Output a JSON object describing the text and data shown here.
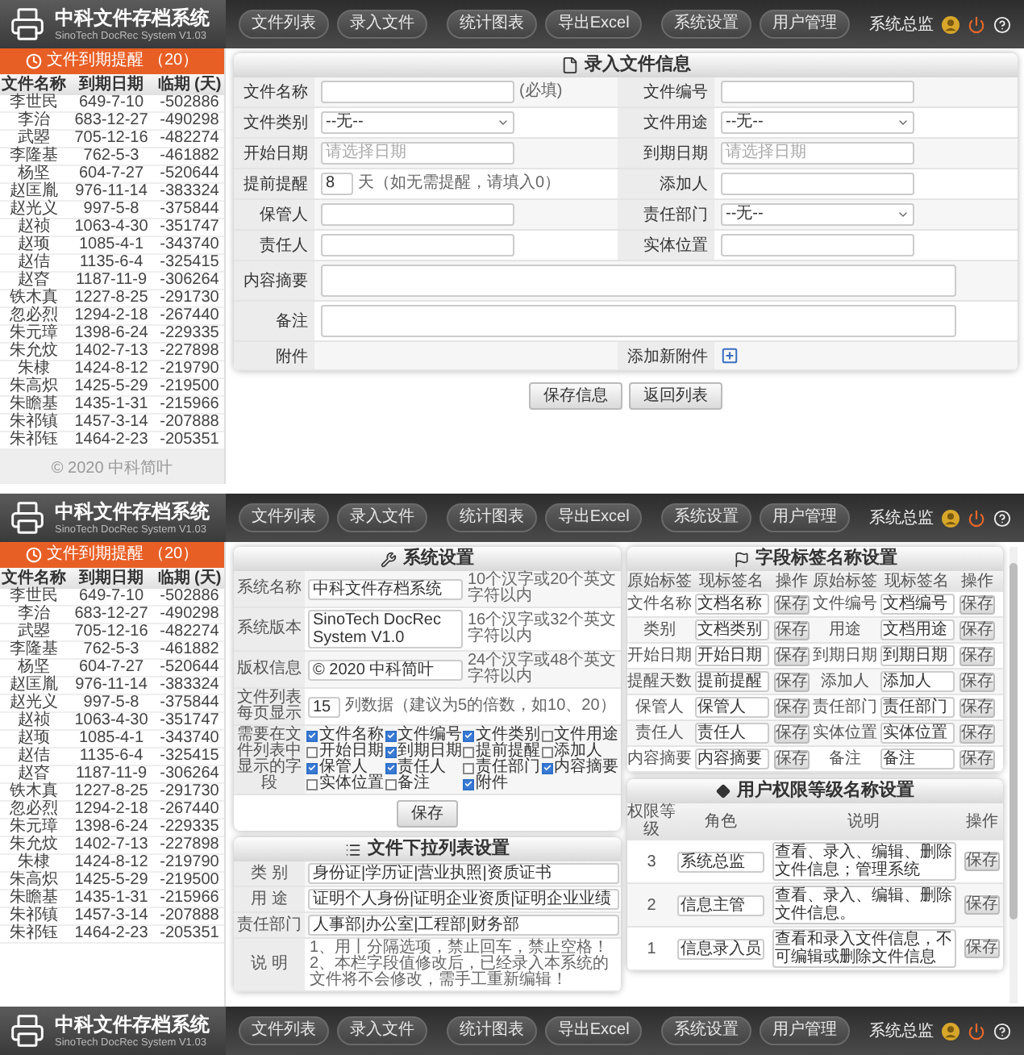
{
  "screens": [
    {
      "kind": "entry",
      "header": {
        "title": "中科文件存档系统",
        "subtitle": "SinoTech DocRec System V1.03",
        "nav": [
          [
            "文件列表",
            "录入文件"
          ],
          [
            "统计图表",
            "导出Excel"
          ],
          [
            "系统设置",
            "用户管理"
          ]
        ],
        "user": "系统总监"
      },
      "sidebar": {
        "title": "文件到期提醒",
        "count": "（20）",
        "columns": [
          "文件名称",
          "到期日期",
          "临期 (天)"
        ],
        "rows": [
          [
            "李世民",
            "649-7-10",
            "-502886"
          ],
          [
            "李治",
            "683-12-27",
            "-490298"
          ],
          [
            "武曌",
            "705-12-16",
            "-482274"
          ],
          [
            "李隆基",
            "762-5-3",
            "-461882"
          ],
          [
            "杨坚",
            "604-7-27",
            "-520644"
          ],
          [
            "赵匡胤",
            "976-11-14",
            "-383324"
          ],
          [
            "赵光义",
            "997-5-8",
            "-375844"
          ],
          [
            "赵祯",
            "1063-4-30",
            "-351747"
          ],
          [
            "赵顼",
            "1085-4-1",
            "-343740"
          ],
          [
            "赵佶",
            "1135-6-4",
            "-325415"
          ],
          [
            "赵昚",
            "1187-11-9",
            "-306264"
          ],
          [
            "铁木真",
            "1227-8-25",
            "-291730"
          ],
          [
            "忽必烈",
            "1294-2-18",
            "-267440"
          ],
          [
            "朱元璋",
            "1398-6-24",
            "-229335"
          ],
          [
            "朱允炆",
            "1402-7-13",
            "-227898"
          ],
          [
            "朱棣",
            "1424-8-12",
            "-219790"
          ],
          [
            "朱高炽",
            "1425-5-29",
            "-219500"
          ],
          [
            "朱瞻基",
            "1435-1-31",
            "-215966"
          ],
          [
            "朱祁镇",
            "1457-3-14",
            "-207888"
          ],
          [
            "朱祁钰",
            "1464-2-23",
            "-205351"
          ]
        ],
        "footer": "© 2020 中科简叶"
      },
      "form": {
        "title": "录入文件信息",
        "rows": [
          {
            "cells": [
              {
                "label": "文件名称",
                "kind": "input",
                "note": "(必填)"
              },
              {
                "label": "文件编号",
                "kind": "input"
              }
            ]
          },
          {
            "cells": [
              {
                "label": "文件类别",
                "kind": "select",
                "value": "--无--"
              },
              {
                "label": "文件用途",
                "kind": "select",
                "value": "--无--"
              }
            ]
          },
          {
            "cells": [
              {
                "label": "开始日期",
                "kind": "input",
                "placeholder": "请选择日期"
              },
              {
                "label": "到期日期",
                "kind": "input",
                "placeholder": "请选择日期"
              }
            ]
          },
          {
            "cells": [
              {
                "label": "提前提醒",
                "kind": "days",
                "value": "8",
                "note": "天（如无需提醒，请填入0）"
              },
              {
                "label": "添加人",
                "kind": "input"
              }
            ]
          },
          {
            "cells": [
              {
                "label": "保管人",
                "kind": "input"
              },
              {
                "label": "责任部门",
                "kind": "select",
                "value": "--无--"
              }
            ]
          },
          {
            "cells": [
              {
                "label": "责任人",
                "kind": "input"
              },
              {
                "label": "实体位置",
                "kind": "input"
              }
            ]
          },
          {
            "cells": [
              {
                "label": "内容摘要",
                "kind": "textarea"
              }
            ]
          },
          {
            "cells": [
              {
                "label": "备注",
                "kind": "textarea"
              }
            ]
          },
          {
            "cells": [
              {
                "label": "附件",
                "kind": "empty"
              },
              {
                "label": "添加新附件",
                "kind": "upload"
              }
            ]
          }
        ],
        "buttons": [
          "保存信息",
          "返回列表"
        ]
      }
    },
    {
      "kind": "settings",
      "header": {
        "title": "中科文件存档系统",
        "subtitle": "SinoTech DocRec System V1.03",
        "nav": [
          [
            "文件列表",
            "录入文件"
          ],
          [
            "统计图表",
            "导出Excel"
          ],
          [
            "系统设置",
            "用户管理"
          ]
        ],
        "user": "系统总监"
      },
      "sidebar": {
        "title": "文件到期提醒",
        "count": "（20）",
        "columns": [
          "文件名称",
          "到期日期",
          "临期 (天)"
        ],
        "rows": [
          [
            "李世民",
            "649-7-10",
            "-502886"
          ],
          [
            "李治",
            "683-12-27",
            "-490298"
          ],
          [
            "武曌",
            "705-12-16",
            "-482274"
          ],
          [
            "李隆基",
            "762-5-3",
            "-461882"
          ],
          [
            "杨坚",
            "604-7-27",
            "-520644"
          ],
          [
            "赵匡胤",
            "976-11-14",
            "-383324"
          ],
          [
            "赵光义",
            "997-5-8",
            "-375844"
          ],
          [
            "赵祯",
            "1063-4-30",
            "-351747"
          ],
          [
            "赵顼",
            "1085-4-1",
            "-343740"
          ],
          [
            "赵佶",
            "1135-6-4",
            "-325415"
          ],
          [
            "赵昚",
            "1187-11-9",
            "-306264"
          ],
          [
            "铁木真",
            "1227-8-25",
            "-291730"
          ],
          [
            "忽必烈",
            "1294-2-18",
            "-267440"
          ],
          [
            "朱元璋",
            "1398-6-24",
            "-229335"
          ],
          [
            "朱允炆",
            "1402-7-13",
            "-227898"
          ],
          [
            "朱棣",
            "1424-8-12",
            "-219790"
          ],
          [
            "朱高炽",
            "1425-5-29",
            "-219500"
          ],
          [
            "朱瞻基",
            "1435-1-31",
            "-215966"
          ],
          [
            "朱祁镇",
            "1457-3-14",
            "-207888"
          ],
          [
            "朱祁钰",
            "1464-2-23",
            "-205351"
          ]
        ]
      },
      "system_settings": {
        "title": "系统设置",
        "rows": [
          {
            "kind": "text",
            "label": "系统名称",
            "value": "中科文件存档系统",
            "note": "10个汉字或20个英文字符以内"
          },
          {
            "kind": "text",
            "label": "系统版本",
            "value": "SinoTech DocRec System V1.0",
            "note": "16个汉字或32个英文字符以内"
          },
          {
            "kind": "text",
            "label": "版权信息",
            "value": "© 2020 中科简叶",
            "note": "24个汉字或48个英文字符以内"
          },
          {
            "kind": "number",
            "label": "文件列表每页显示",
            "value": "15",
            "note": "列数据（建议为5的倍数，如10、20）"
          },
          {
            "kind": "checks",
            "label": "需要在文件列表中显示的字段",
            "options": [
              {
                "label": "文件名称",
                "checked": true
              },
              {
                "label": "文件编号",
                "checked": true
              },
              {
                "label": "文件类别",
                "checked": true
              },
              {
                "label": "文件用途",
                "checked": false
              },
              {
                "label": "开始日期",
                "checked": false
              },
              {
                "label": "到期日期",
                "checked": true
              },
              {
                "label": "提前提醒",
                "checked": false
              },
              {
                "label": "添加人",
                "checked": false
              },
              {
                "label": "保管人",
                "checked": true
              },
              {
                "label": "责任人",
                "checked": true
              },
              {
                "label": "责任部门",
                "checked": false
              },
              {
                "label": "内容摘要",
                "checked": true
              },
              {
                "label": "实体位置",
                "checked": false
              },
              {
                "label": "备注",
                "checked": false
              },
              {
                "label": "附件",
                "checked": true
              }
            ]
          }
        ],
        "button": "保存"
      },
      "dropdown_settings": {
        "title": "文件下拉列表设置",
        "rows": [
          {
            "label": "类 别",
            "value": "身份证|学历证|营业执照|资质证书"
          },
          {
            "label": "用 途",
            "value": "证明个人身份|证明企业资质|证明企业业绩"
          },
          {
            "label": "责任部门",
            "value": "人事部|办公室|工程部|财务部"
          }
        ],
        "note": {
          "label": "说 明",
          "lines": [
            "1、用丨分隔选项，禁止回车，禁止空格！",
            "2、本栏字段值修改后，已经录入本系统的文件将不会修改，需手工重新编辑！"
          ]
        }
      },
      "field_labels": {
        "title": "字段标签名称设置",
        "columns": [
          "原始标签",
          "现标签名",
          "操作",
          "原始标签",
          "现标签名",
          "操作"
        ],
        "rows": [
          [
            "文件名称",
            "文档名称",
            "保存",
            "文件编号",
            "文档编号",
            "保存"
          ],
          [
            "类别",
            "文档类别",
            "保存",
            "用途",
            "文档用途",
            "保存"
          ],
          [
            "开始日期",
            "开始日期",
            "保存",
            "到期日期",
            "到期日期",
            "保存"
          ],
          [
            "提醒天数",
            "提前提醒",
            "保存",
            "添加人",
            "添加人",
            "保存"
          ],
          [
            "保管人",
            "保管人",
            "保存",
            "责任部门",
            "责任部门",
            "保存"
          ],
          [
            "责任人",
            "责任人",
            "保存",
            "实体位置",
            "实体位置",
            "保存"
          ],
          [
            "内容摘要",
            "内容摘要",
            "保存",
            "备注",
            "备注",
            "保存"
          ]
        ]
      },
      "user_levels": {
        "title": "用户权限等级名称设置",
        "columns": [
          "权限等级",
          "角色",
          "说明",
          "操作"
        ],
        "rows": [
          {
            "level": "3",
            "role": "系统总监",
            "description": "查看、录入、编辑、删除文件信息；管理系统",
            "button": "保存"
          },
          {
            "level": "2",
            "role": "信息主管",
            "description": "查看、录入、编辑、删除文件信息。",
            "button": "保存"
          },
          {
            "level": "1",
            "role": "信息录入员",
            "description": "查看和录入文件信息，不可编辑或删除文件信息",
            "button": "保存"
          }
        ]
      }
    },
    {
      "kind": "header",
      "header": {
        "title": "中科文件存档系统",
        "subtitle": "SinoTech DocRec System V1.03",
        "nav": [
          [
            "文件列表",
            "录入文件"
          ],
          [
            "统计图表",
            "导出Excel"
          ],
          [
            "系统设置",
            "用户管理"
          ]
        ],
        "user": "系统总监"
      }
    }
  ]
}
